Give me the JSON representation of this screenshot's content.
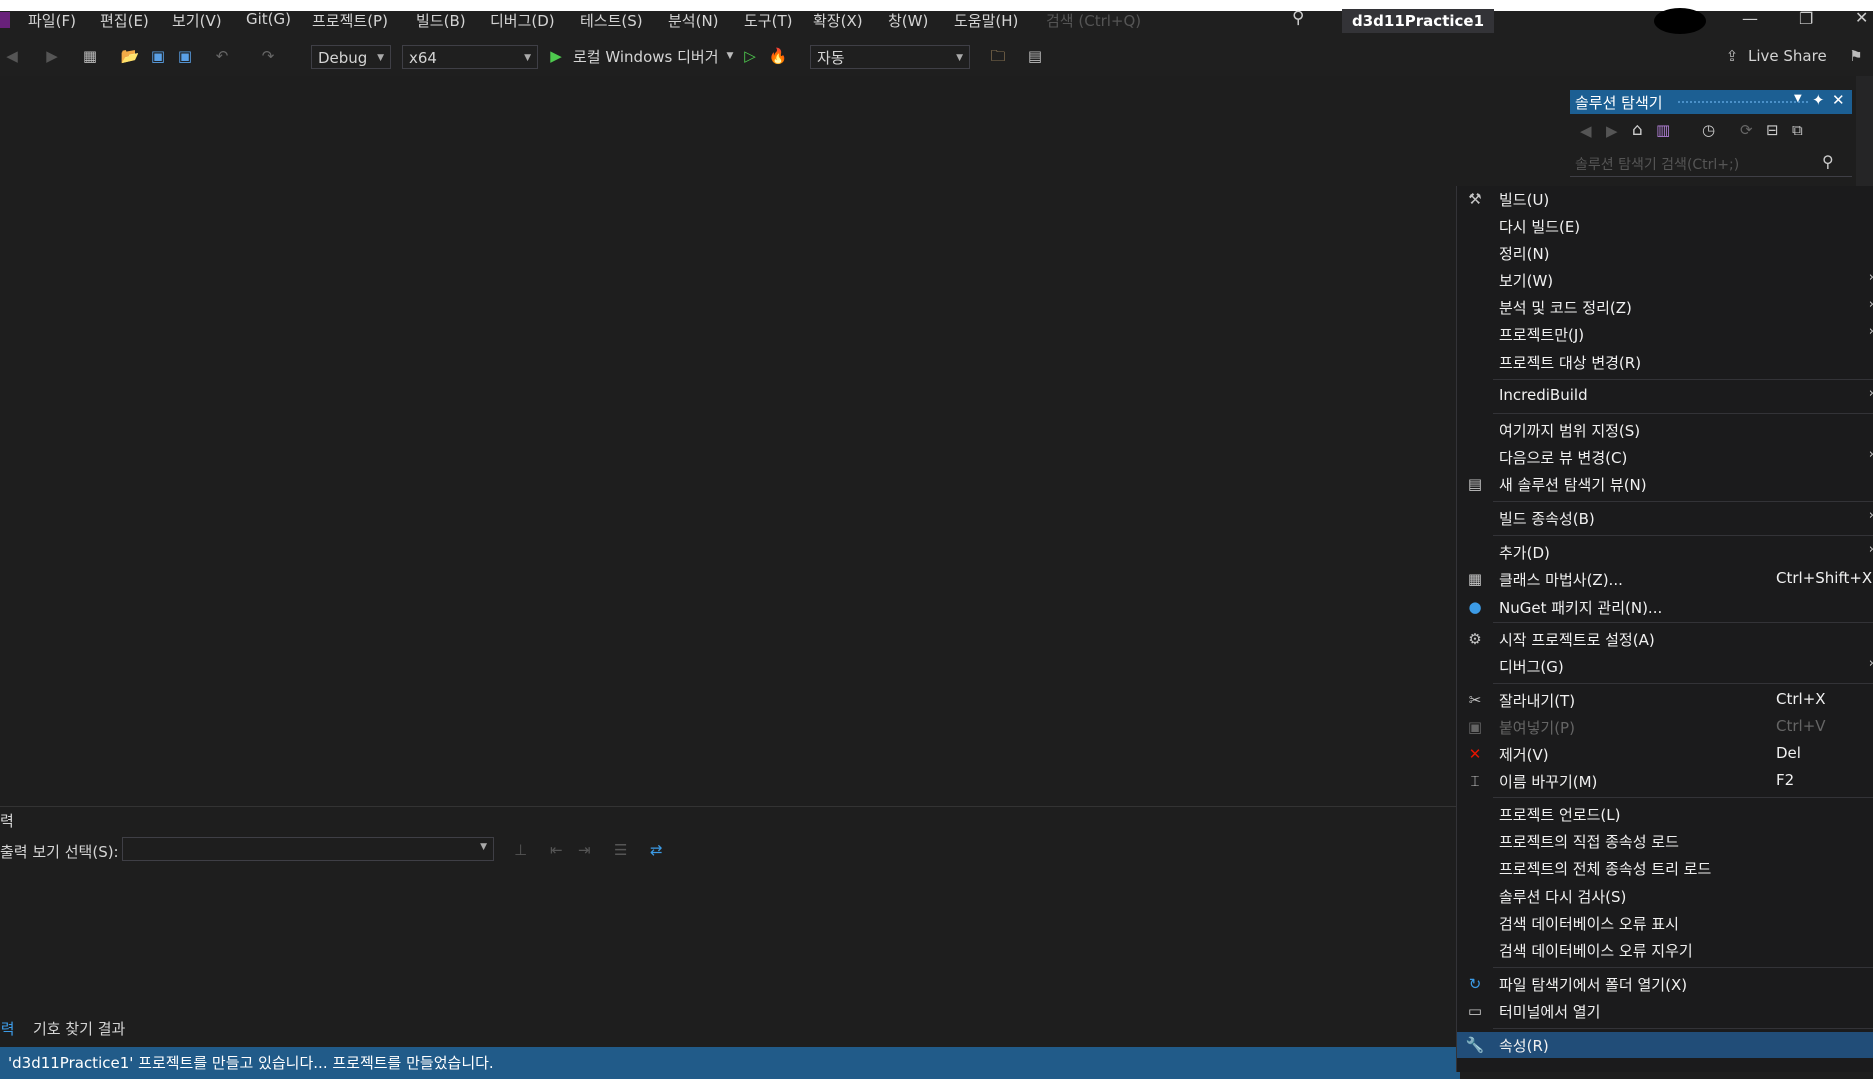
{
  "menubar": {
    "items": [
      "파일(F)",
      "편집(E)",
      "보기(V)",
      "Git(G)",
      "프로젝트(P)",
      "빌드(B)",
      "디버그(D)",
      "테스트(S)",
      "분석(N)",
      "도구(T)",
      "확장(X)",
      "창(W)",
      "도움말(H)"
    ],
    "search_placeholder": "검색 (Ctrl+Q)",
    "solution_name": "d3d11Practice1"
  },
  "toolbar": {
    "config": "Debug",
    "platform": "x64",
    "run_label": "로컬 Windows 디버거",
    "auto_label": "자동",
    "live_share": "Live Share"
  },
  "solution_explorer": {
    "title": "솔루션 탐색기",
    "search_placeholder": "솔루션 탐색기 검색(Ctrl+;)"
  },
  "output": {
    "title": "력",
    "select_label": "출력 보기 선택(S):",
    "tabs": [
      "출력",
      "기호 찾기 결과"
    ]
  },
  "status": {
    "message": "'d3d11Practice1' 프로젝트를 만들고 있습니다... 프로젝트를 만들었습니다."
  },
  "context_menu": {
    "items": [
      {
        "label": "빌드(U)",
        "icon": "build-icon"
      },
      {
        "label": "다시 빌드(E)"
      },
      {
        "label": "정리(N)"
      },
      {
        "label": "보기(W)",
        "submenu": true
      },
      {
        "label": "분석 및 코드 정리(Z)",
        "submenu": true
      },
      {
        "label": "프로젝트만(J)",
        "submenu": true
      },
      {
        "label": "프로젝트 대상 변경(R)"
      },
      {
        "label": "IncrediBuild",
        "submenu": true
      },
      {
        "label": "여기까지 범위 지정(S)"
      },
      {
        "label": "다음으로 뷰 변경(C)",
        "submenu": true
      },
      {
        "label": "새 솔루션 탐색기 뷰(N)",
        "icon": "new-view-icon"
      },
      {
        "label": "빌드 종속성(B)",
        "submenu": true
      },
      {
        "label": "추가(D)",
        "submenu": true
      },
      {
        "label": "클래스 마법사(Z)...",
        "shortcut": "Ctrl+Shift+X",
        "icon": "class-wizard-icon"
      },
      {
        "label": "NuGet 패키지 관리(N)...",
        "icon": "nuget-icon"
      },
      {
        "label": "시작 프로젝트로 설정(A)",
        "icon": "gear-icon"
      },
      {
        "label": "디버그(G)",
        "submenu": true
      },
      {
        "label": "잘라내기(T)",
        "shortcut": "Ctrl+X",
        "icon": "scissors-icon"
      },
      {
        "label": "붙여넣기(P)",
        "shortcut": "Ctrl+V",
        "icon": "paste-icon",
        "disabled": true
      },
      {
        "label": "제거(V)",
        "shortcut": "Del",
        "icon": "delete-icon"
      },
      {
        "label": "이름 바꾸기(M)",
        "shortcut": "F2",
        "icon": "rename-icon"
      },
      {
        "label": "프로젝트 언로드(L)"
      },
      {
        "label": "프로젝트의 직접 종속성 로드"
      },
      {
        "label": "프로젝트의 전체 종속성 트리 로드"
      },
      {
        "label": "솔루션 다시 검사(S)"
      },
      {
        "label": "검색 데이터베이스 오류 표시"
      },
      {
        "label": "검색 데이터베이스 오류 지우기"
      },
      {
        "label": "파일 탐색기에서 폴더 열기(X)",
        "icon": "open-folder-icon"
      },
      {
        "label": "터미널에서 열기",
        "icon": "terminal-icon"
      },
      {
        "label": "속성(R)",
        "icon": "wrench-icon",
        "highlight": true
      }
    ]
  },
  "colors": {
    "accent": "#007acc",
    "status_bar": "#215b89",
    "selection": "#214d78",
    "run_green": "#4ec94e"
  }
}
